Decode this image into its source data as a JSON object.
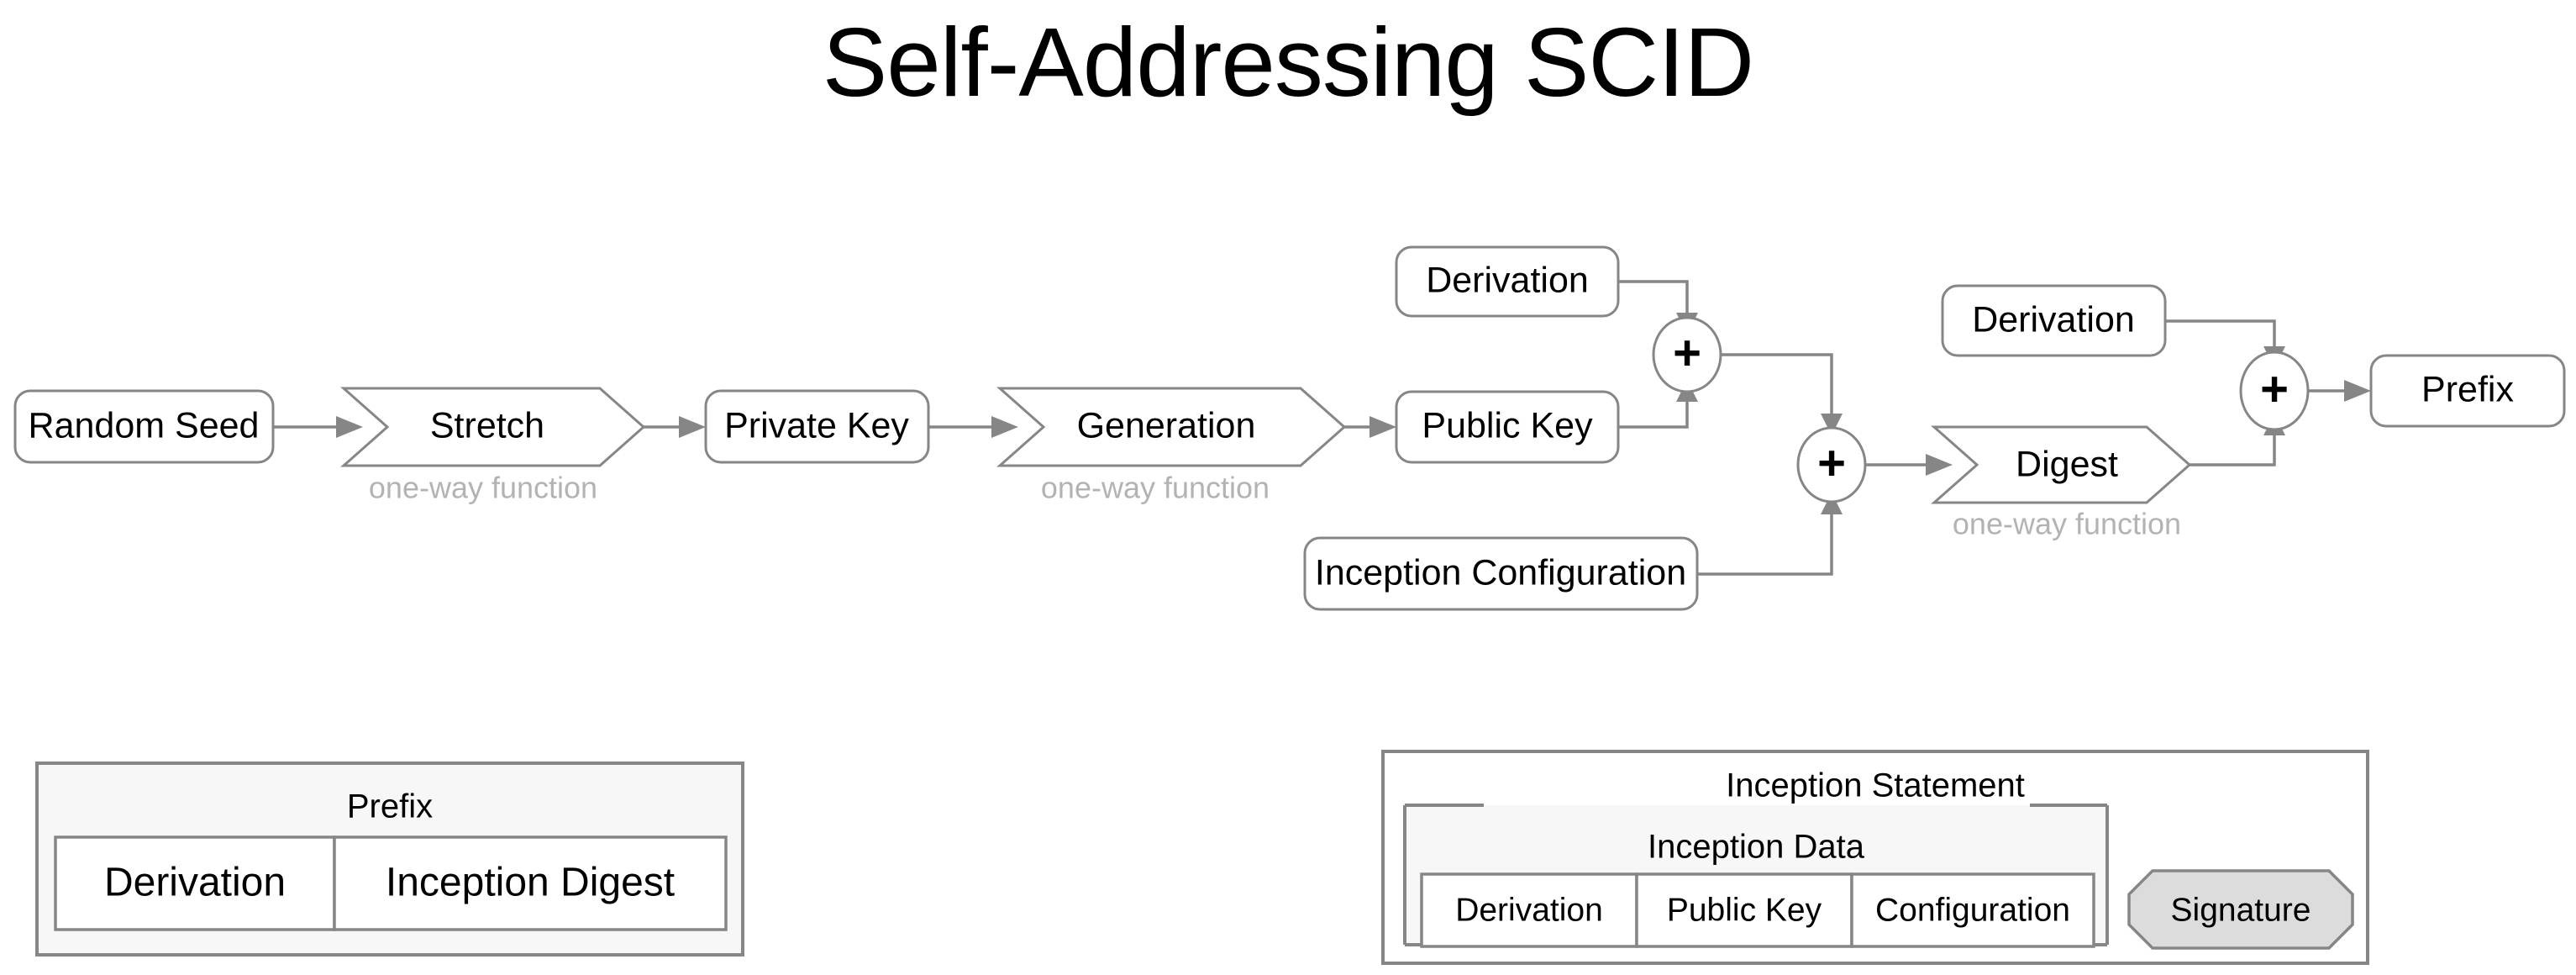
{
  "title": "Self-Addressing SCID",
  "flow": {
    "nodes": {
      "random_seed": "Random Seed",
      "stretch": "Stretch",
      "private_key": "Private Key",
      "generation": "Generation",
      "public_key": "Public Key",
      "derivation_top": "Derivation",
      "inception_configuration": "Inception Configuration",
      "derivation_right": "Derivation",
      "digest": "Digest",
      "prefix": "Prefix"
    },
    "operators": {
      "plus_1": "+",
      "plus_2": "+",
      "plus_3": "+"
    },
    "captions": {
      "stretch_caption": "one-way function",
      "generation_caption": "one-way function",
      "digest_caption": "one-way function"
    }
  },
  "prefix_group": {
    "title": "Prefix",
    "cells": [
      "Derivation",
      "Inception Digest"
    ]
  },
  "inception_group": {
    "title": "Inception Statement",
    "data_title": "Inception Data",
    "data_cells": [
      "Derivation",
      "Public Key",
      "Configuration"
    ],
    "signature": "Signature"
  },
  "colors": {
    "stroke": "#868686",
    "group_fill": "#f7f7f7",
    "signature_fill": "#dcdcdc",
    "caption_text": "#b3b3b3",
    "text": "#000000",
    "background": "#ffffff"
  }
}
